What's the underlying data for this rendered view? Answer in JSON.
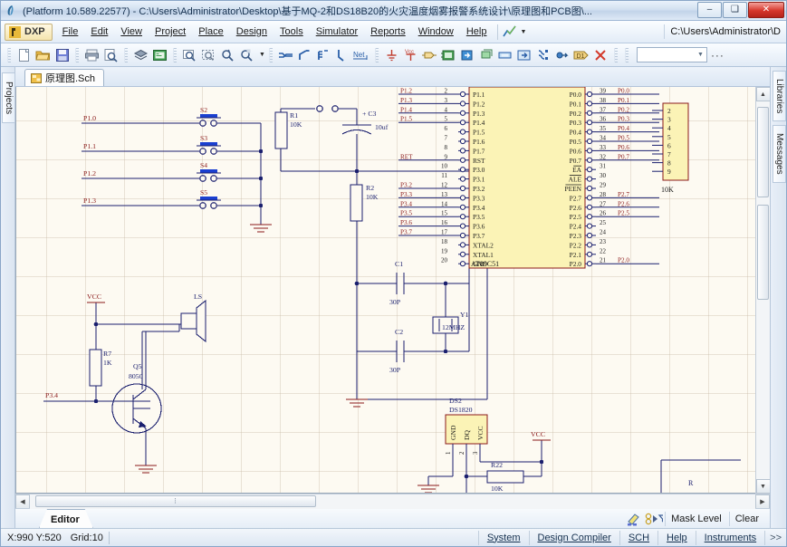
{
  "window": {
    "title": "(Platform 10.589.22577) - C:\\Users\\Administrator\\Desktop\\基于MQ-2和DS18B20的火灾温度烟雾报警系统设计\\原理图和PCB图\\...",
    "icon": "altium-feather-icon",
    "minimize_label": "–",
    "maximize_label": "❑",
    "close_label": "✕"
  },
  "menu": {
    "dxp_label": "DXP",
    "items": [
      {
        "label": "File",
        "accel": "F"
      },
      {
        "label": "Edit",
        "accel": "E"
      },
      {
        "label": "View",
        "accel": "V"
      },
      {
        "label": "Project",
        "accel": "j"
      },
      {
        "label": "Place",
        "accel": "P"
      },
      {
        "label": "Design",
        "accel": "D"
      },
      {
        "label": "Tools",
        "accel": "T"
      },
      {
        "label": "Simulator",
        "accel": "S"
      },
      {
        "label": "Reports",
        "accel": "R"
      },
      {
        "label": "Window",
        "accel": "W"
      },
      {
        "label": "Help",
        "accel": "H"
      }
    ],
    "path_label": "C:\\Users\\Administrator\\D"
  },
  "toolbar": {
    "groups": [
      [
        "new-document-icon",
        "open-folder-icon",
        "save-icon"
      ],
      [
        "print-icon",
        "print-preview-icon"
      ],
      [
        "open-library-icon",
        "browse-library-icon"
      ],
      [
        "zoom-area-icon",
        "zoom-selection-icon",
        "zoom-filter-icon",
        "zoom-mask-icon"
      ],
      [
        "place-wire-icon",
        "place-bus-icon",
        "place-bus-entry-icon",
        "place-line-icon",
        "place-netlabel-icon"
      ],
      [
        "place-gnd-icon",
        "place-vcc-icon",
        "place-part-icon",
        "place-sheet-symbol-icon",
        "place-sheet-entry-icon",
        "place-device-sheet-icon",
        "place-port-icon",
        "place-noerc-icon",
        "place-directive-icon",
        "place-designator-icon",
        "delete-icon"
      ]
    ],
    "combo_value": "",
    "overflow_label": "···"
  },
  "panels": {
    "left_tabs": [
      "Projects"
    ],
    "right_tabs": [
      "Libraries",
      "Messages"
    ]
  },
  "document": {
    "tab_label": "原理图.Sch",
    "tab_icon": "schematic-document-icon"
  },
  "schematic": {
    "ic": {
      "designator": "AT89C51",
      "left_pins": [
        {
          "num": "2",
          "name": "P1.1",
          "net": "P1.2"
        },
        {
          "num": "3",
          "name": "P1.2",
          "net": "P1.3"
        },
        {
          "num": "4",
          "name": "P1.3",
          "net": "P1.4"
        },
        {
          "num": "5",
          "name": "P1.4",
          "net": "P1.5"
        },
        {
          "num": "6",
          "name": "P1.5",
          "net": ""
        },
        {
          "num": "7",
          "name": "P1.6",
          "net": ""
        },
        {
          "num": "8",
          "name": "P1.7",
          "net": ""
        },
        {
          "num": "9",
          "name": "RST",
          "net": "RET"
        },
        {
          "num": "10",
          "name": "P3.0",
          "net": ""
        },
        {
          "num": "11",
          "name": "P3.1",
          "net": ""
        },
        {
          "num": "12",
          "name": "P3.2",
          "net": "P3.2"
        },
        {
          "num": "13",
          "name": "P3.3",
          "net": "P3.3"
        },
        {
          "num": "14",
          "name": "P3.4",
          "net": "P3.4"
        },
        {
          "num": "15",
          "name": "P3.5",
          "net": "P3.5"
        },
        {
          "num": "16",
          "name": "P3.6",
          "net": "P3.6"
        },
        {
          "num": "17",
          "name": "P3.7",
          "net": "P3.7"
        },
        {
          "num": "18",
          "name": "XTAL2",
          "net": ""
        },
        {
          "num": "19",
          "name": "XTAL1",
          "net": ""
        },
        {
          "num": "20",
          "name": "GND",
          "net": ""
        }
      ],
      "right_pins": [
        {
          "num": "39",
          "name": "P0.0",
          "net": "P0.0"
        },
        {
          "num": "38",
          "name": "P0.1",
          "net": "P0.1"
        },
        {
          "num": "37",
          "name": "P0.2",
          "net": "P0.2"
        },
        {
          "num": "36",
          "name": "P0.3",
          "net": "P0.3"
        },
        {
          "num": "35",
          "name": "P0.4",
          "net": "P0.4"
        },
        {
          "num": "34",
          "name": "P0.5",
          "net": "P0.5"
        },
        {
          "num": "33",
          "name": "P0.6",
          "net": "P0.6"
        },
        {
          "num": "32",
          "name": "P0.7",
          "net": "P0.7"
        },
        {
          "num": "31",
          "name": "EA",
          "net": ""
        },
        {
          "num": "30",
          "name": "ALE",
          "net": ""
        },
        {
          "num": "29",
          "name": "PEEN",
          "net": ""
        },
        {
          "num": "28",
          "name": "P2.7",
          "net": "P2.7"
        },
        {
          "num": "27",
          "name": "P2.6",
          "net": "P2.6"
        },
        {
          "num": "26",
          "name": "P2.5",
          "net": "P2.5"
        },
        {
          "num": "25",
          "name": "P2.4",
          "net": ""
        },
        {
          "num": "24",
          "name": "P2.3",
          "net": ""
        },
        {
          "num": "23",
          "name": "P2.2",
          "net": ""
        },
        {
          "num": "22",
          "name": "P2.1",
          "net": ""
        },
        {
          "num": "21",
          "name": "P2.0",
          "net": "P2.0"
        }
      ]
    },
    "switches": [
      {
        "designator": "S2",
        "net": "P1.0"
      },
      {
        "designator": "S3",
        "net": "P1.1"
      },
      {
        "designator": "S4",
        "net": "P1.2"
      },
      {
        "designator": "S5",
        "net": "P1.3"
      }
    ],
    "resistors": [
      {
        "designator": "R1",
        "value": "10K"
      },
      {
        "designator": "R2",
        "value": "10K"
      },
      {
        "designator": "R7",
        "value": "1K"
      },
      {
        "designator": "R22",
        "value": "10K"
      }
    ],
    "capacitors": [
      {
        "designator": "C1",
        "value": "30P"
      },
      {
        "designator": "C2",
        "value": "30P"
      },
      {
        "designator": "C3",
        "value": "10uf",
        "polarity": "+"
      }
    ],
    "crystal": {
      "designator": "Y1",
      "value": "12MHZ"
    },
    "transistor": {
      "designator": "Q5",
      "value": "8050",
      "base_net": "P3.4"
    },
    "speaker": {
      "designator": "LS"
    },
    "sensor": {
      "designator": "DS2",
      "part": "DS1820",
      "pins": [
        "GND",
        "DQ",
        "VCC"
      ],
      "pin_numbers": [
        "1",
        "2",
        "3"
      ]
    },
    "connector": {
      "value": "10K",
      "pins": [
        "2",
        "3",
        "4",
        "5",
        "6",
        "7",
        "8",
        "9"
      ]
    },
    "power_labels": [
      "VCC",
      "VCC"
    ],
    "bottom_part_label": "R"
  },
  "editor": {
    "tab_label": "Editor",
    "highlight_icon": "highlight-icon",
    "mask-filter_icon": "mask-filter-icon",
    "mask_level_label": "Mask Level",
    "clear_label": "Clear"
  },
  "status": {
    "coords": "X:990 Y:520",
    "grid": "Grid:10",
    "buttons": [
      {
        "label": "System",
        "accel": "S"
      },
      {
        "label": "Design Compiler",
        "accel": "D"
      },
      {
        "label": "SCH",
        "accel": "C"
      },
      {
        "label": "Help",
        "accel": "H"
      },
      {
        "label": "Instruments",
        "accel": "I"
      }
    ],
    "more_label": ">>"
  },
  "colors": {
    "canvas_bg": "#fdfaf2",
    "wire": "#1a1f6e",
    "part_body": "#fbf3b6",
    "part_outline": "#8b1a1a",
    "net_label": "#8b1a1a",
    "grid": "#c8b9a5"
  }
}
